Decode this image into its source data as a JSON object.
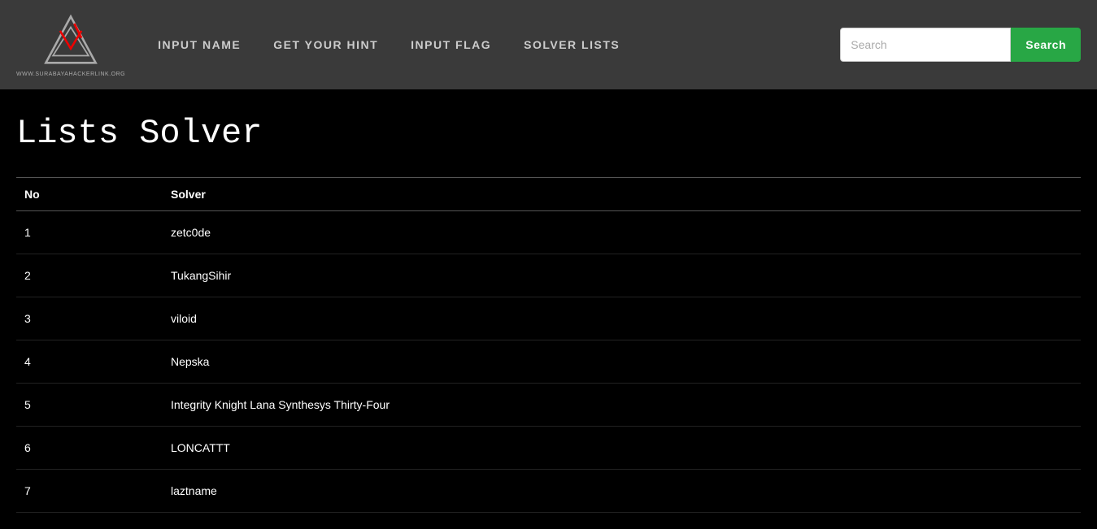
{
  "navbar": {
    "logo_tagline": "WWW.SURABAYAHACKERLINK.ORG",
    "links": [
      {
        "label": "INPUT NAME",
        "name": "nav-input-name"
      },
      {
        "label": "GET YOUR HINT",
        "name": "nav-get-hint"
      },
      {
        "label": "INPUT FLAG",
        "name": "nav-input-flag"
      },
      {
        "label": "SOLVER LISTS",
        "name": "nav-solver-lists"
      }
    ],
    "search_placeholder": "Search",
    "search_button_label": "Search"
  },
  "main": {
    "page_title": "Lists Solver",
    "table": {
      "headers": [
        "No",
        "Solver"
      ],
      "rows": [
        {
          "no": "1",
          "solver": "zetc0de"
        },
        {
          "no": "2",
          "solver": "TukangSihir"
        },
        {
          "no": "3",
          "solver": "viloid"
        },
        {
          "no": "4",
          "solver": "Nepska"
        },
        {
          "no": "5",
          "solver": "Integrity Knight Lana Synthesys Thirty-Four"
        },
        {
          "no": "6",
          "solver": "LONCATTT"
        },
        {
          "no": "7",
          "solver": "laztname"
        }
      ]
    }
  }
}
